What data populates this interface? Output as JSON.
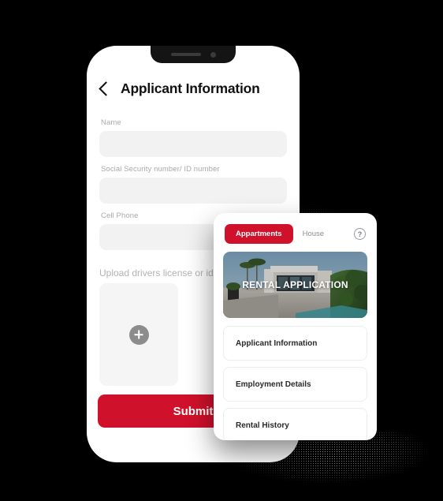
{
  "theme": {
    "accent_red": "#D0112B",
    "background": "#000000",
    "field_gray": "#F2F2F3",
    "label_gray": "#A9A9AE",
    "plus_gray": "#8C8C8C"
  },
  "phone": {
    "header": {
      "back_icon": "chevron-left-icon",
      "title": "Applicant Information"
    },
    "fields": [
      {
        "label": "Name",
        "value": "",
        "placeholder": ""
      },
      {
        "label": "Social Security number/ ID number",
        "value": "",
        "placeholder": ""
      },
      {
        "label": "Cell Phone",
        "value": "",
        "placeholder": ""
      }
    ],
    "upload": {
      "label": "Upload drivers license or identification",
      "add_icon": "plus-icon"
    },
    "submit_label": "Submit"
  },
  "card": {
    "tabs": [
      {
        "label": "Appartments",
        "active": true
      },
      {
        "label": "House",
        "active": false
      }
    ],
    "help_icon": "question-mark-circle-icon",
    "help_glyph": "?",
    "hero": {
      "title": "RENTAL APPLICATION",
      "image_alt": "modern-villa-with-pool-photo"
    },
    "list": [
      {
        "label": "Applicant Information"
      },
      {
        "label": "Employment Details"
      },
      {
        "label": "Rental History"
      }
    ]
  }
}
